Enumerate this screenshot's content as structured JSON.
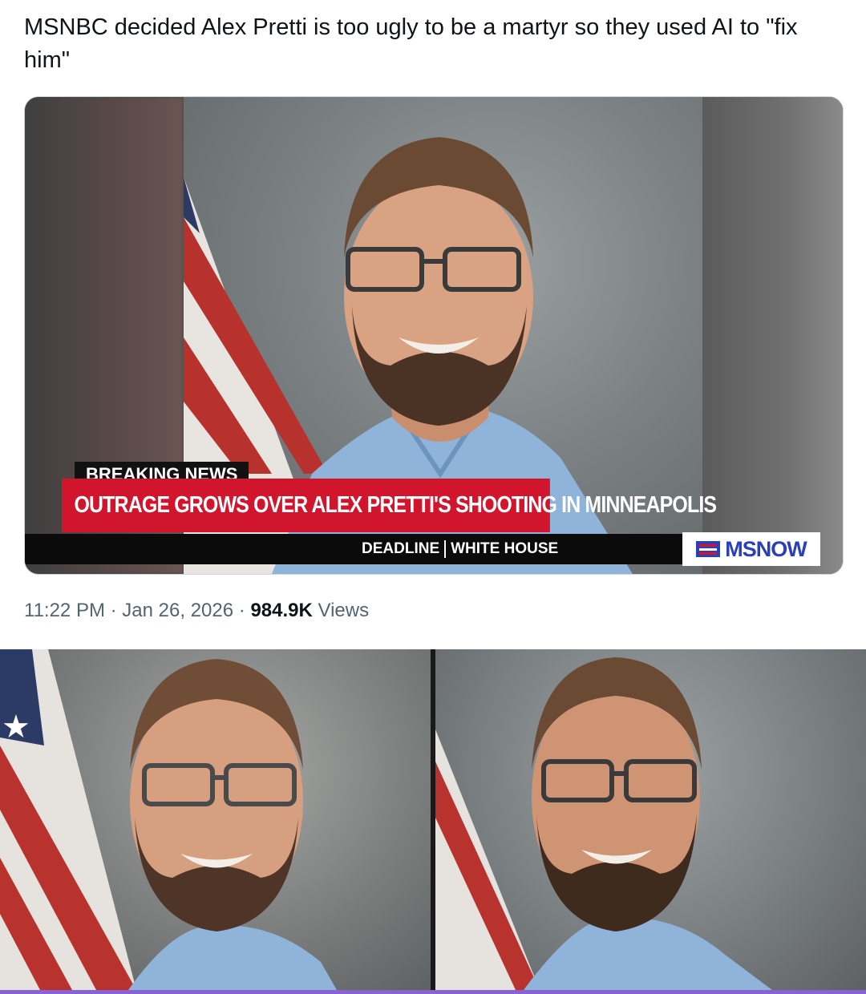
{
  "tweet": {
    "text": "MSNBC decided Alex Pretti is too ugly to be a martyr so they used AI to \"fix him\"",
    "time": "11:22 PM",
    "separator": "·",
    "date": "Jan 26, 2026",
    "views_count": "984.9K",
    "views_label": "Views"
  },
  "broadcast": {
    "label": "BREAKING NEWS",
    "headline": "OUTRAGE GROWS OVER ALEX PRETTI'S SHOOTING IN MINNEAPOLIS",
    "ticker_left": "DEADLINE",
    "ticker_right": "WHITE HOUSE",
    "network": "MSNOW"
  },
  "colors": {
    "headline_red": "#d0152d",
    "logo_blue": "#2a3fb8",
    "scrubs_blue": "#8fb3d9",
    "accent_bar": "#8a63d2"
  }
}
